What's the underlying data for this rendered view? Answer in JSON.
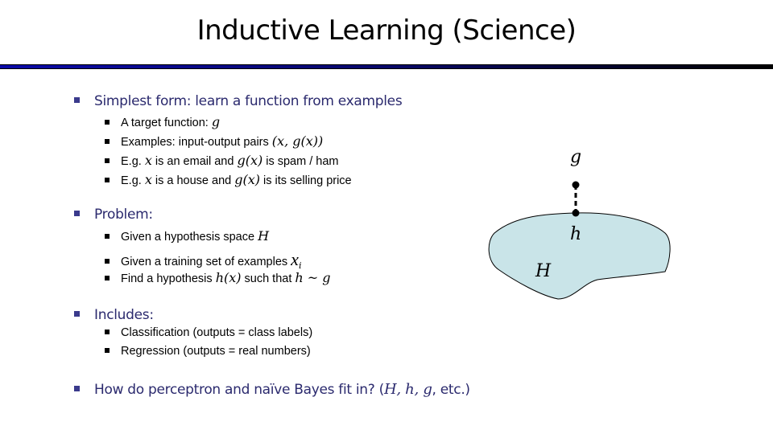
{
  "title": "Inductive Learning (Science)",
  "bullets": {
    "simplest": "Simplest form: learn a function from examples",
    "target_prefix": "A target function: ",
    "target_var": "g",
    "examples_prefix": "Examples: input-output pairs ",
    "examples_math": "(x, g(x))",
    "email_prefix": "E.g. ",
    "email_x": "x",
    "email_mid": " is an email and ",
    "email_gx": "g(x)",
    "email_suffix": " is spam / ham",
    "house_prefix": "E.g. ",
    "house_x": "x",
    "house_mid": " is a house and ",
    "house_gx": "g(x)",
    "house_suffix": " is its selling price",
    "problem": "Problem:",
    "hyp_space_prefix": "Given a hypothesis space ",
    "hyp_space_var": "H",
    "training_prefix": "Given a training set of examples ",
    "training_var": "x",
    "training_sub": "i",
    "find_prefix": "Find a hypothesis ",
    "find_hx": "h(x)",
    "find_mid": " such that ",
    "find_rel": "h ~ g",
    "includes": "Includes:",
    "classification": "Classification (outputs = class labels)",
    "regression": "Regression (outputs = real numbers)",
    "how_prefix": "How do perceptron and naïve Bayes fit in?  (",
    "how_math": "H, h, g",
    "how_suffix": ", etc.)"
  },
  "diagram": {
    "label_g": "g",
    "label_h": "h",
    "label_H": "H",
    "region_fill": "#c9e4e8"
  },
  "colors": {
    "top_bullet_text": "#2b2a6e",
    "rule_start": "#0a0aa8",
    "rule_end": "#000000"
  }
}
